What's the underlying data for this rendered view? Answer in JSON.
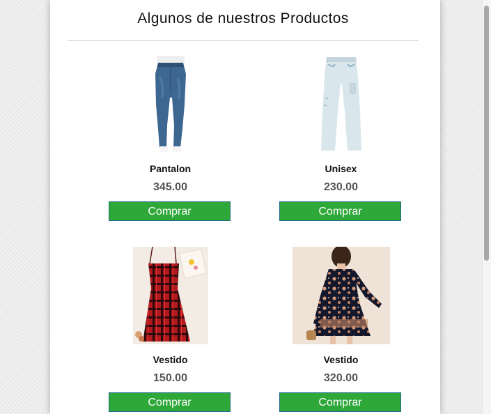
{
  "page": {
    "title": "Algunos de nuestros Productos"
  },
  "products": [
    {
      "name": "Pantalon",
      "price": "345.00",
      "button_label": "Comprar",
      "image": "jeans-image"
    },
    {
      "name": "Unisex",
      "price": "230.00",
      "button_label": "Comprar",
      "image": "light-jeans-image"
    },
    {
      "name": "Vestido",
      "price": "150.00",
      "button_label": "Comprar",
      "image": "plaid-dress-image"
    },
    {
      "name": "Vestido",
      "price": "320.00",
      "button_label": "Comprar",
      "image": "floral-dress-image"
    }
  ],
  "colors": {
    "buy_button": "#2fa83a",
    "buy_button_border": "#1e6b8a",
    "price_text": "#555555",
    "background": "#f1f1f1"
  }
}
